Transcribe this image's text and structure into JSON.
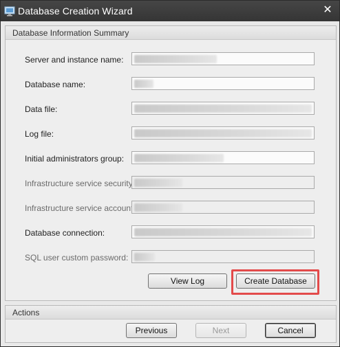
{
  "window": {
    "title": "Database Creation Wizard",
    "close_glyph": "✕",
    "icon": "monitor-icon"
  },
  "summary": {
    "header": "Database Information Summary",
    "rows": [
      {
        "label": "Server and instance name:",
        "enabled": true
      },
      {
        "label": "Database name:",
        "enabled": true
      },
      {
        "label": "Data file:",
        "enabled": true
      },
      {
        "label": "Log file:",
        "enabled": true
      },
      {
        "label": "Initial administrators group:",
        "enabled": true
      },
      {
        "label": "Infrastructure service security:",
        "enabled": false
      },
      {
        "label": "Infrastructure service account:",
        "enabled": false
      },
      {
        "label": "Database connection:",
        "enabled": true
      },
      {
        "label": "SQL user custom password:",
        "enabled": false
      }
    ],
    "view_log_label": "View Log",
    "create_database_label": "Create Database"
  },
  "actions": {
    "header": "Actions",
    "previous_label": "Previous",
    "next_label": "Next",
    "cancel_label": "Cancel"
  },
  "colors": {
    "title_bar": "#3c3c3c",
    "highlight": "#e34a4a"
  }
}
